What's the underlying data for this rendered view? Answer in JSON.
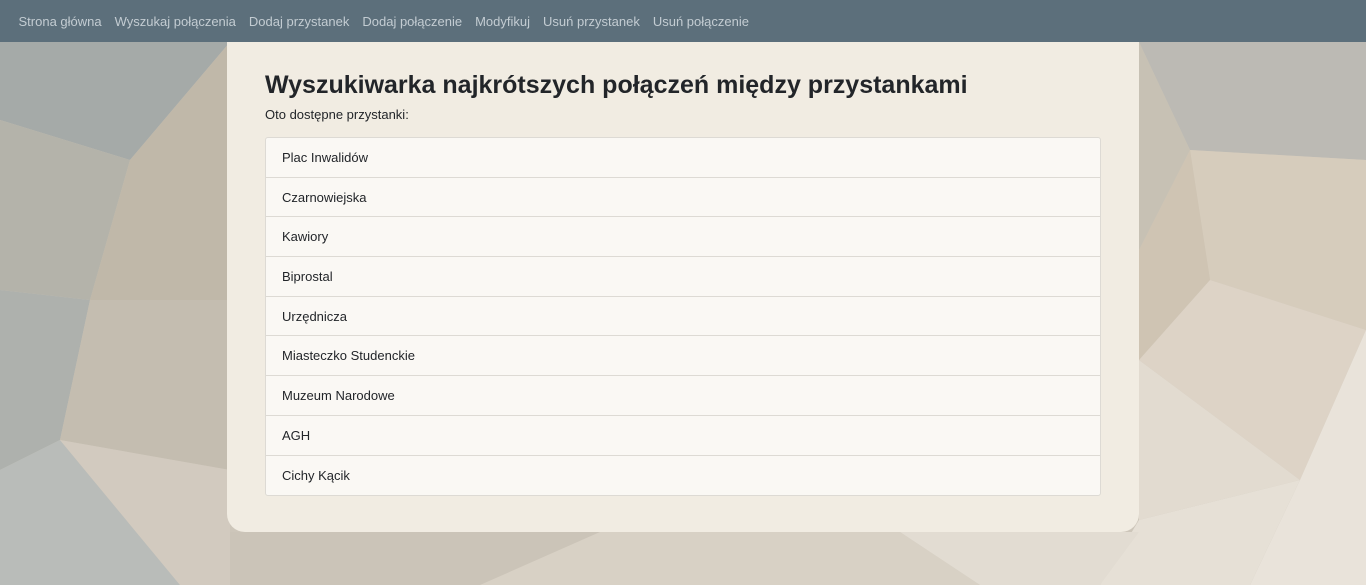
{
  "nav": {
    "items": [
      "Strona główna",
      "Wyszukaj połączenia",
      "Dodaj przystanek",
      "Dodaj połączenie",
      "Modyfikuj",
      "Usuń przystanek",
      "Usuń połączenie"
    ]
  },
  "main": {
    "title": "Wyszukiwarka najkrótszych połączeń między przystankami",
    "subtitle": "Oto dostępne przystanki:",
    "stops": [
      "Plac Inwalidów",
      "Czarnowiejska",
      "Kawiory",
      "Biprostal",
      "Urzędnicza",
      "Miasteczko Studenckie",
      "Muzeum Narodowe",
      "AGH",
      "Cichy Kącik"
    ]
  },
  "colors": {
    "navbar": "#5c6f7b",
    "nav_text": "#c3ccd2",
    "card": "#f1ece2",
    "list_bg": "#faf8f4"
  }
}
